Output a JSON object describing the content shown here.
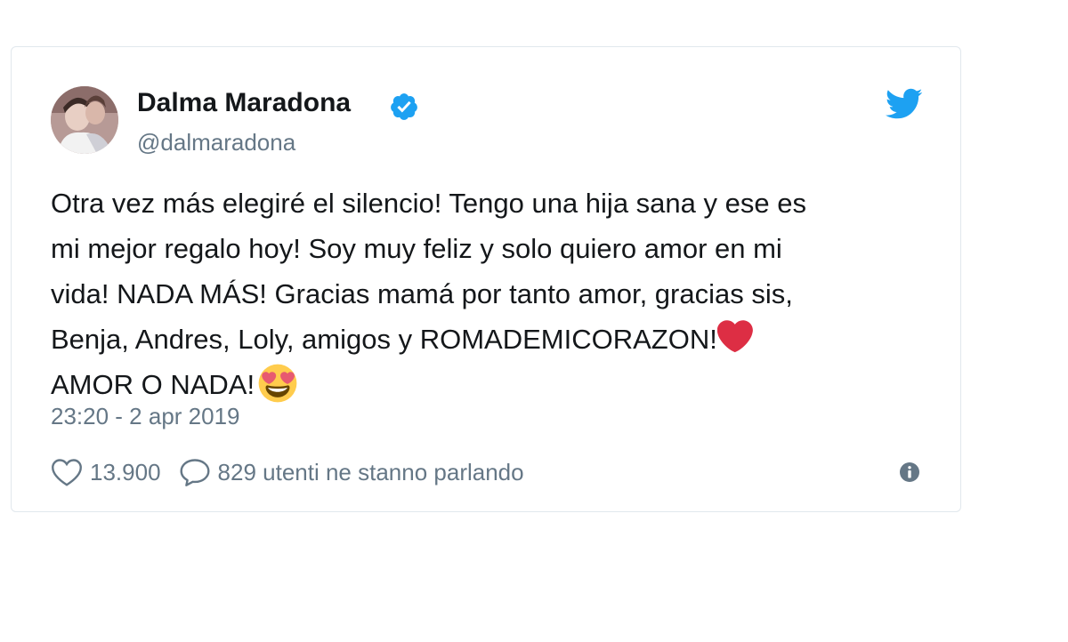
{
  "tweet": {
    "author": {
      "display_name": "Dalma Maradona",
      "handle": "@dalmaradona",
      "verified": true,
      "avatar_icon": "avatar-photo"
    },
    "brand_icon": "twitter-bird-icon",
    "text_lines": [
      "Otra vez más elegiré el silencio! Tengo una hija sana y ese es",
      "mi mejor regalo hoy! Soy muy feliz y solo quiero amor en mi",
      "vida! NADA MÁS! Gracias mamá por tanto amor, gracias sis,",
      "Benja, Andres, Loly, amigos y ROMADEMICORAZON!",
      "AMOR O NADA!"
    ],
    "emojis": {
      "line4_end": "❤️",
      "line5_end": "😍"
    },
    "timestamp": "23:20 - 2 apr 2019",
    "likes": "13.900",
    "replies_text": "829 utenti ne stanno parlando",
    "colors": {
      "twitter_blue": "#1da1f2",
      "secondary_text": "#657786",
      "border": "#e1e8ed",
      "heart_red": "#e0245e"
    }
  }
}
